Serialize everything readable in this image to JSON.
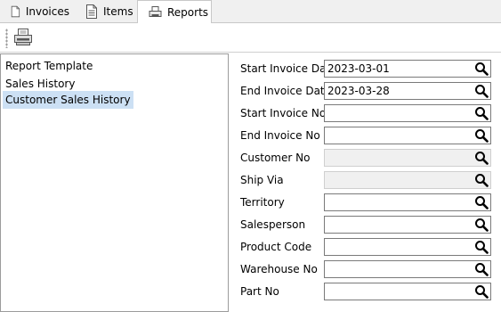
{
  "tabs": [
    {
      "label": "Invoices",
      "icon": "document-icon"
    },
    {
      "label": "Items",
      "icon": "list-document-icon"
    },
    {
      "label": "Reports",
      "icon": "printer-icon",
      "active": true
    }
  ],
  "toolbar": {
    "print_icon": "printer-icon"
  },
  "report_list": [
    {
      "label": "Report Template"
    },
    {
      "label": "Sales History"
    },
    {
      "label": "Customer Sales History",
      "selected": true
    }
  ],
  "form": {
    "fields": [
      {
        "label": "Start Invoice Date",
        "value": "2023-03-01",
        "disabled": false
      },
      {
        "label": "End Invoice Date",
        "value": "2023-03-28",
        "disabled": false
      },
      {
        "label": "Start Invoice No",
        "value": "",
        "disabled": false
      },
      {
        "label": "End Invoice No",
        "value": "",
        "disabled": false
      },
      {
        "label": "Customer No",
        "value": "",
        "disabled": true
      },
      {
        "label": "Ship Via",
        "value": "",
        "disabled": true
      },
      {
        "label": "Territory",
        "value": "",
        "disabled": false
      },
      {
        "label": "Salesperson",
        "value": "",
        "disabled": false
      },
      {
        "label": "Product Code",
        "value": "",
        "disabled": false
      },
      {
        "label": "Warehouse No",
        "value": "",
        "disabled": false
      },
      {
        "label": "Part No",
        "value": "",
        "disabled": false
      }
    ]
  },
  "colors": {
    "selection": "#cce0f4",
    "disabled_field": "#f0f0f0"
  }
}
